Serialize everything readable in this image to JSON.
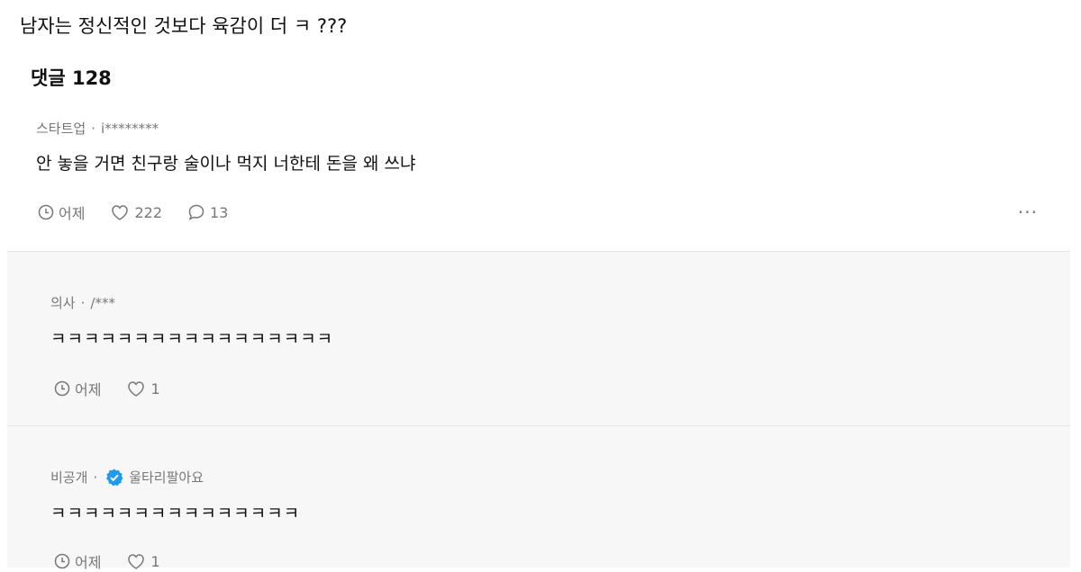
{
  "post": {
    "title": "남자는 정신적인 것보다 육감이 더 ㅋ ???"
  },
  "comments_header": {
    "label": "댓글 128"
  },
  "comment": {
    "company": "스타트업",
    "separator": "·",
    "user": "i********",
    "body": "안 놓을 거면 친구랑 술이나 먹지 너한테 돈을 왜 쓰냐",
    "time": "어제",
    "likes": "222",
    "replies": "13",
    "more": "···"
  },
  "replies": [
    {
      "company": "의사",
      "separator": "·",
      "user": "/***",
      "body": "ㅋㅋㅋㅋㅋㅋㅋㅋㅋㅋㅋㅋㅋㅋㅋㅋㅋ",
      "time": "어제",
      "likes": "1"
    },
    {
      "company": "비공개",
      "separator": "·",
      "user": "울타리팔아요",
      "body": "ㅋㅋㅋㅋㅋㅋㅋㅋㅋㅋㅋㅋㅋㅋㅋ",
      "time": "어제",
      "likes": "1",
      "verified": true
    }
  ],
  "colors": {
    "text": "#111111",
    "meta": "#777777",
    "reply_bg": "#f7f7f8",
    "verified_badge": "#1e9bf0"
  }
}
